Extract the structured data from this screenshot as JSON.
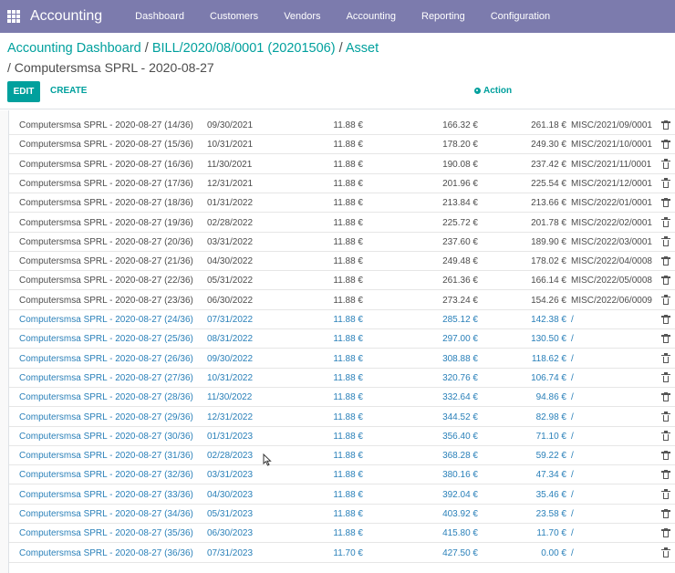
{
  "navbar": {
    "app_name": "Accounting",
    "items": [
      "Dashboard",
      "Customers",
      "Vendors",
      "Accounting",
      "Reporting",
      "Configuration"
    ]
  },
  "breadcrumb": {
    "items": [
      "Accounting Dashboard",
      "BILL/2020/08/0001 (20201506)",
      "Asset"
    ],
    "separator": "/",
    "current": "/ Computersmsa SPRL - 2020-08-27"
  },
  "buttons": {
    "edit": "EDIT",
    "create": "CREATE",
    "action": "Action"
  },
  "colors": {
    "navbar": "#7c7bad",
    "accent": "#00a09d",
    "posted_text": "#4c4c4c",
    "draft_text": "#2a80b9"
  },
  "lines": [
    {
      "name": "Computersmsa SPRL - 2020-08-27 (14/36)",
      "date": "09/30/2021",
      "amount": "11.88 €",
      "cumulative": "166.32 €",
      "residual": "261.18 €",
      "move": "MISC/2021/09/0001",
      "state": "posted"
    },
    {
      "name": "Computersmsa SPRL - 2020-08-27 (15/36)",
      "date": "10/31/2021",
      "amount": "11.88 €",
      "cumulative": "178.20 €",
      "residual": "249.30 €",
      "move": "MISC/2021/10/0001",
      "state": "posted"
    },
    {
      "name": "Computersmsa SPRL - 2020-08-27 (16/36)",
      "date": "11/30/2021",
      "amount": "11.88 €",
      "cumulative": "190.08 €",
      "residual": "237.42 €",
      "move": "MISC/2021/11/0001",
      "state": "posted"
    },
    {
      "name": "Computersmsa SPRL - 2020-08-27 (17/36)",
      "date": "12/31/2021",
      "amount": "11.88 €",
      "cumulative": "201.96 €",
      "residual": "225.54 €",
      "move": "MISC/2021/12/0001",
      "state": "posted"
    },
    {
      "name": "Computersmsa SPRL - 2020-08-27 (18/36)",
      "date": "01/31/2022",
      "amount": "11.88 €",
      "cumulative": "213.84 €",
      "residual": "213.66 €",
      "move": "MISC/2022/01/0001",
      "state": "posted"
    },
    {
      "name": "Computersmsa SPRL - 2020-08-27 (19/36)",
      "date": "02/28/2022",
      "amount": "11.88 €",
      "cumulative": "225.72 €",
      "residual": "201.78 €",
      "move": "MISC/2022/02/0001",
      "state": "posted"
    },
    {
      "name": "Computersmsa SPRL - 2020-08-27 (20/36)",
      "date": "03/31/2022",
      "amount": "11.88 €",
      "cumulative": "237.60 €",
      "residual": "189.90 €",
      "move": "MISC/2022/03/0001",
      "state": "posted"
    },
    {
      "name": "Computersmsa SPRL - 2020-08-27 (21/36)",
      "date": "04/30/2022",
      "amount": "11.88 €",
      "cumulative": "249.48 €",
      "residual": "178.02 €",
      "move": "MISC/2022/04/0008",
      "state": "posted"
    },
    {
      "name": "Computersmsa SPRL - 2020-08-27 (22/36)",
      "date": "05/31/2022",
      "amount": "11.88 €",
      "cumulative": "261.36 €",
      "residual": "166.14 €",
      "move": "MISC/2022/05/0008",
      "state": "posted"
    },
    {
      "name": "Computersmsa SPRL - 2020-08-27 (23/36)",
      "date": "06/30/2022",
      "amount": "11.88 €",
      "cumulative": "273.24 €",
      "residual": "154.26 €",
      "move": "MISC/2022/06/0009",
      "state": "posted"
    },
    {
      "name": "Computersmsa SPRL - 2020-08-27 (24/36)",
      "date": "07/31/2022",
      "amount": "11.88 €",
      "cumulative": "285.12 €",
      "residual": "142.38 €",
      "move": "/",
      "state": "draft"
    },
    {
      "name": "Computersmsa SPRL - 2020-08-27 (25/36)",
      "date": "08/31/2022",
      "amount": "11.88 €",
      "cumulative": "297.00 €",
      "residual": "130.50 €",
      "move": "/",
      "state": "draft"
    },
    {
      "name": "Computersmsa SPRL - 2020-08-27 (26/36)",
      "date": "09/30/2022",
      "amount": "11.88 €",
      "cumulative": "308.88 €",
      "residual": "118.62 €",
      "move": "/",
      "state": "draft"
    },
    {
      "name": "Computersmsa SPRL - 2020-08-27 (27/36)",
      "date": "10/31/2022",
      "amount": "11.88 €",
      "cumulative": "320.76 €",
      "residual": "106.74 €",
      "move": "/",
      "state": "draft"
    },
    {
      "name": "Computersmsa SPRL - 2020-08-27 (28/36)",
      "date": "11/30/2022",
      "amount": "11.88 €",
      "cumulative": "332.64 €",
      "residual": "94.86 €",
      "move": "/",
      "state": "draft"
    },
    {
      "name": "Computersmsa SPRL - 2020-08-27 (29/36)",
      "date": "12/31/2022",
      "amount": "11.88 €",
      "cumulative": "344.52 €",
      "residual": "82.98 €",
      "move": "/",
      "state": "draft"
    },
    {
      "name": "Computersmsa SPRL - 2020-08-27 (30/36)",
      "date": "01/31/2023",
      "amount": "11.88 €",
      "cumulative": "356.40 €",
      "residual": "71.10 €",
      "move": "/",
      "state": "draft"
    },
    {
      "name": "Computersmsa SPRL - 2020-08-27 (31/36)",
      "date": "02/28/2023",
      "amount": "11.88 €",
      "cumulative": "368.28 €",
      "residual": "59.22 €",
      "move": "/",
      "state": "draft"
    },
    {
      "name": "Computersmsa SPRL - 2020-08-27 (32/36)",
      "date": "03/31/2023",
      "amount": "11.88 €",
      "cumulative": "380.16 €",
      "residual": "47.34 €",
      "move": "/",
      "state": "draft"
    },
    {
      "name": "Computersmsa SPRL - 2020-08-27 (33/36)",
      "date": "04/30/2023",
      "amount": "11.88 €",
      "cumulative": "392.04 €",
      "residual": "35.46 €",
      "move": "/",
      "state": "draft"
    },
    {
      "name": "Computersmsa SPRL - 2020-08-27 (34/36)",
      "date": "05/31/2023",
      "amount": "11.88 €",
      "cumulative": "403.92 €",
      "residual": "23.58 €",
      "move": "/",
      "state": "draft"
    },
    {
      "name": "Computersmsa SPRL - 2020-08-27 (35/36)",
      "date": "06/30/2023",
      "amount": "11.88 €",
      "cumulative": "415.80 €",
      "residual": "11.70 €",
      "move": "/",
      "state": "draft"
    },
    {
      "name": "Computersmsa SPRL - 2020-08-27 (36/36)",
      "date": "07/31/2023",
      "amount": "11.70 €",
      "cumulative": "427.50 €",
      "residual": "0.00 €",
      "move": "/",
      "state": "draft"
    }
  ]
}
